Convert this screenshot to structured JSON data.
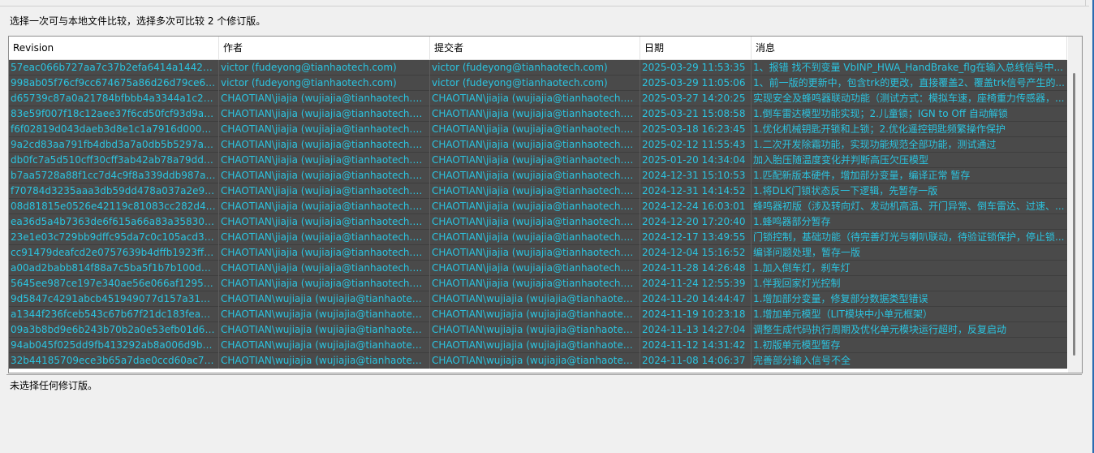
{
  "instruction": "选择一次可与本地文件比较，选择多次可比较 2 个修订版。",
  "columns": [
    "Revision",
    "作者",
    "提交者",
    "日期",
    "消息"
  ],
  "rows": [
    [
      "57eac066b727aa7c37b2efa6414a1442931...",
      "victor (fudeyong@tianhaotech.com)",
      "victor (fudeyong@tianhaotech.com)",
      "2025-03-29 11:53:35",
      "1、报错 找不到变量 VbINP_HWA_HandBrake_flg在输入总线信号中..."
    ],
    [
      "998ab05f76cf9cc674675a86d26d79ce6c5d...",
      "victor (fudeyong@tianhaotech.com)",
      "victor (fudeyong@tianhaotech.com)",
      "2025-03-29 11:05:06",
      "1、前一版的更新中，包含trk的更改，直接覆盖2、覆盖trk信号产生的..."
    ],
    [
      "d65739c87a0a21784bfbbb4a3344a1c2868...",
      "CHAOTIAN\\jiajia (wujiajia@tianhaotech.com)",
      "CHAOTIAN\\jiajia (wujiajia@tianhaotech.com)",
      "2025-03-27 14:20:25",
      "实现安全及蜂鸣器联动功能（测试方式：模拟车速，座椅重力传感器，..."
    ],
    [
      "83e59f007f18c12aee37f6cd50fcf93d9ae57...",
      "CHAOTIAN\\jiajia (wujiajia@tianhaotech.com)",
      "CHAOTIAN\\jiajia (wujiajia@tianhaotech.com)",
      "2025-03-21 15:08:58",
      "1.倒车雷达模型功能实现；2.儿童锁；IGN to Off 自动解锁"
    ],
    [
      "f6f02819d043daeb3d8e1c1a7916d00081cf...",
      "CHAOTIAN\\jiajia (wujiajia@tianhaotech.com)",
      "CHAOTIAN\\jiajia (wujiajia@tianhaotech.com)",
      "2025-03-18 16:23:45",
      "1.优化机械钥匙开锁和上锁；2.优化遥控钥匙频繁操作保护"
    ],
    [
      "9a2cd83aa791fb4dbd3a7a0db5b5297a30...",
      "CHAOTIAN\\jiajia (wujiajia@tianhaotech.com)",
      "CHAOTIAN\\jiajia (wujiajia@tianhaotech.com)",
      "2025-02-12 11:55:43",
      "1.二次开发除霜功能，实现功能规范全部功能，测试通过"
    ],
    [
      "db0fc7a5d510cff30cff3ab42ab78a79dd0bf...",
      "CHAOTIAN\\jiajia (wujiajia@tianhaotech.com)",
      "CHAOTIAN\\jiajia (wujiajia@tianhaotech.com)",
      "2025-01-20 14:34:04",
      "加入胎压随温度变化并判断高压欠压模型"
    ],
    [
      "b7aa5728a88f1cc7d4c9f8a339ddb987a598...",
      "CHAOTIAN\\jiajia (wujiajia@tianhaotech.com)",
      "CHAOTIAN\\jiajia (wujiajia@tianhaotech.com)",
      "2024-12-31 15:10:53",
      "1.匹配新版本硬件，增加部分变量，编译正常 暂存"
    ],
    [
      "f70784d3235aaa3db59dd478a037a2e97a3...",
      "CHAOTIAN\\jiajia (wujiajia@tianhaotech.com)",
      "CHAOTIAN\\jiajia (wujiajia@tianhaotech.com)",
      "2024-12-31 14:14:52",
      "1.将DLK门锁状态反一下逻辑，先暂存一版"
    ],
    [
      "08d81815e0526e42119c81083cc282d4458...",
      "CHAOTIAN\\jiajia (wujiajia@tianhaotech.com)",
      "CHAOTIAN\\jiajia (wujiajia@tianhaotech.com)",
      "2024-12-24 16:03:01",
      "蜂鸣器初版（涉及转向灯、发动机高温、开门异常、倒车雷达、过速、..."
    ],
    [
      "ea36d5a4b7363de6f615a66a83a3583066e...",
      "CHAOTIAN\\jiajia (wujiajia@tianhaotech.com)",
      "CHAOTIAN\\jiajia (wujiajia@tianhaotech.com)",
      "2024-12-20 17:20:40",
      "1.蜂鸣器部分暂存"
    ],
    [
      "23e1e03c729bb9dffc95da7c0c105acd38ae...",
      "CHAOTIAN\\jiajia (wujiajia@tianhaotech.com)",
      "CHAOTIAN\\jiajia (wujiajia@tianhaotech.com)",
      "2024-12-17 13:49:55",
      "门锁控制，基础功能（待完善灯光与喇叭联动，待验证锁保护，停止锁..."
    ],
    [
      "cc91479deafcd2e0757639b4dffb1923ffd46...",
      "CHAOTIAN\\jiajia (wujiajia@tianhaotech.com)",
      "CHAOTIAN\\jiajia (wujiajia@tianhaotech.com)",
      "2024-12-04 15:16:52",
      "编译问题处理，暂存一版"
    ],
    [
      "a00ad2babb814f88a7c5ba5f1b7b100da8d...",
      "CHAOTIAN\\jiajia (wujiajia@tianhaotech.com)",
      "CHAOTIAN\\jiajia (wujiajia@tianhaotech.com)",
      "2024-11-28 14:26:48",
      "1.加入倒车灯，刹车灯"
    ],
    [
      "5645ee987ce197e340ae56e066af12952677...",
      "CHAOTIAN\\jiajia (wujiajia@tianhaotech.com)",
      "CHAOTIAN\\jiajia (wujiajia@tianhaotech.com)",
      "2024-11-24 12:55:39",
      "1.伴我回家灯光控制"
    ],
    [
      "9d5847c4291abcb451949077d157a31357c...",
      "CHAOTIAN\\wujiajia (wujiajia@tianhaotech....",
      "CHAOTIAN\\wujiajia (wujiajia@tianhaotech....",
      "2024-11-20 14:44:47",
      "1.增加部分变量，修复部分数据类型错误"
    ],
    [
      "a1344f236fceb543c67b67f21dc183feade2...",
      "CHAOTIAN\\wujiajia (wujiajia@tianhaotech....",
      "CHAOTIAN\\wujiajia (wujiajia@tianhaotech....",
      "2024-11-19 10:23:18",
      "1.增加单元模型（LIT模块中小单元框架）"
    ],
    [
      "09a3b8bd9e6b243b70b2a0e53efb01d677...",
      "CHAOTIAN\\wujiajia (wujiajia@tianhaotech....",
      "CHAOTIAN\\wujiajia (wujiajia@tianhaotech....",
      "2024-11-13 14:27:04",
      "调整生成代码执行周期及优化单元模块运行超时，反复启动"
    ],
    [
      "94ab045f025dd9fb413292ab8a006d9bd1d...",
      "CHAOTIAN\\wujiajia (wujiajia@tianhaotech....",
      "CHAOTIAN\\wujiajia (wujiajia@tianhaotech....",
      "2024-11-12 14:31:42",
      "1.初版单元模型暂存"
    ],
    [
      "32b44185709ece3b65a7dae0ccd60ac78a3...",
      "CHAOTIAN\\wujiajia (wujiajia@tianhaotech....",
      "CHAOTIAN\\wujiajia (wujiajia@tianhaotech....",
      "2024-11-08 14:06:37",
      "完善部分输入信号不全"
    ]
  ],
  "status": "未选择任何修订版。",
  "colors": {
    "row_bg": "#4a4a4a",
    "row_text": "#2bc4e0",
    "window_bg": "#f0f0f0",
    "accent_border": "#2b6cb0"
  }
}
